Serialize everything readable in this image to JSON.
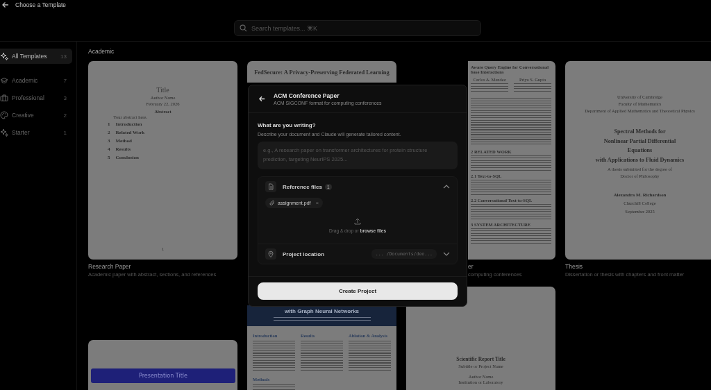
{
  "header": {
    "title": "Choose a Template"
  },
  "search": {
    "placeholder": "Search templates... ⌘K"
  },
  "sidebar": {
    "items": [
      {
        "label": "All Templates",
        "count": "13",
        "selected": true
      },
      {
        "label": "Academic",
        "count": "7",
        "selected": false
      },
      {
        "label": "Professional",
        "count": "3",
        "selected": false
      },
      {
        "label": "Creative",
        "count": "2",
        "selected": false
      },
      {
        "label": "Starter",
        "count": "1",
        "selected": false
      }
    ]
  },
  "section_title": "Academic",
  "columns": [
    [
      {
        "kind": "paper",
        "name": "Research Paper",
        "description": "Academic paper with abstract, sections, and references",
        "preview": {
          "title": "Title",
          "author": "Author Name",
          "date": "February 22, 2026",
          "abstract_heading": "Abstract",
          "abstract": "Your abstract here.",
          "sections": [
            {
              "number": "1",
              "title": "Introduction"
            },
            {
              "number": "2",
              "title": "Related Work"
            },
            {
              "number": "3",
              "title": "Method"
            },
            {
              "number": "4",
              "title": "Results"
            },
            {
              "number": "5",
              "title": "Conclusion"
            }
          ],
          "page": "1"
        }
      },
      {
        "kind": "presentation",
        "preview": {
          "title": "Presentation Title"
        }
      }
    ],
    [
      {
        "kind": "partial",
        "preview": {
          "title": "FedSecure: A Privacy-Preserving Federated Learning"
        }
      },
      {
        "kind": "poster",
        "preview": {
          "title": "with Graph Neural Networks",
          "headings": [
            "Introduction",
            "Results",
            "Ablation & Analysis"
          ],
          "lower_heading": "Methods"
        }
      }
    ],
    [
      {
        "kind": "acm",
        "name": "er",
        "description": "computing conferences",
        "preview": {
          "title": [
            "Aware Query Engine for Conversational",
            "base Interactions"
          ],
          "authors": [
            "Carlos A. Mendez",
            "Priya S. Gupta"
          ],
          "headings": [
            "2 RELATED WORK",
            "2.1 Text-to-SQL",
            "2.2 Conversational Text-to-SQL",
            "3 SYSTEM ARCHITECTURE"
          ]
        }
      },
      {
        "kind": "report",
        "preview": {
          "title": "Scientific Report Title",
          "subtitle": "Subtitle or Project Name",
          "author": "Author Name",
          "institution": "Institution or Laboratory"
        }
      }
    ],
    [
      {
        "kind": "thesis",
        "name": "Thesis",
        "description": "Dissertation or thesis with chapters and front matter",
        "preview": {
          "university": "University of Cambridge",
          "faculty": "Faculty of Mathematics",
          "department": "Department of Applied Mathematics and Theoretical Physics",
          "title": [
            "Spectral Methods for",
            "Nonlinear Partial Differential",
            "Equations",
            "with Applications to Fluid Dynamics"
          ],
          "degree_note": "A thesis submitted for the degree of",
          "degree": "Doctor of Philosophy",
          "author": "Alexandra M. Richardson",
          "college": "Churchill College",
          "date": "September 2025"
        }
      }
    ]
  ],
  "dialog": {
    "title": "ACM Conference Paper",
    "subtitle": "ACM SIGCONF format for computing conferences",
    "prompt_label": "What are you writing?",
    "prompt_help": "Describe your document and Claude will generate tailored content.",
    "prompt_placeholder": "e.g., A research paper on transformer architectures for protein structure prediction, targeting NeurIPS 2025...",
    "reference_files": {
      "label": "Reference files",
      "count": "1",
      "expanded": true,
      "files": [
        {
          "name": "assignment.pdf",
          "remove": "×"
        }
      ],
      "drop_text": "Drag & drop or",
      "browse_link": "browse files"
    },
    "project_location": {
      "label": "Project location",
      "path": "... /Documents/dee...",
      "expanded": false
    },
    "create_button": "Create Project"
  }
}
